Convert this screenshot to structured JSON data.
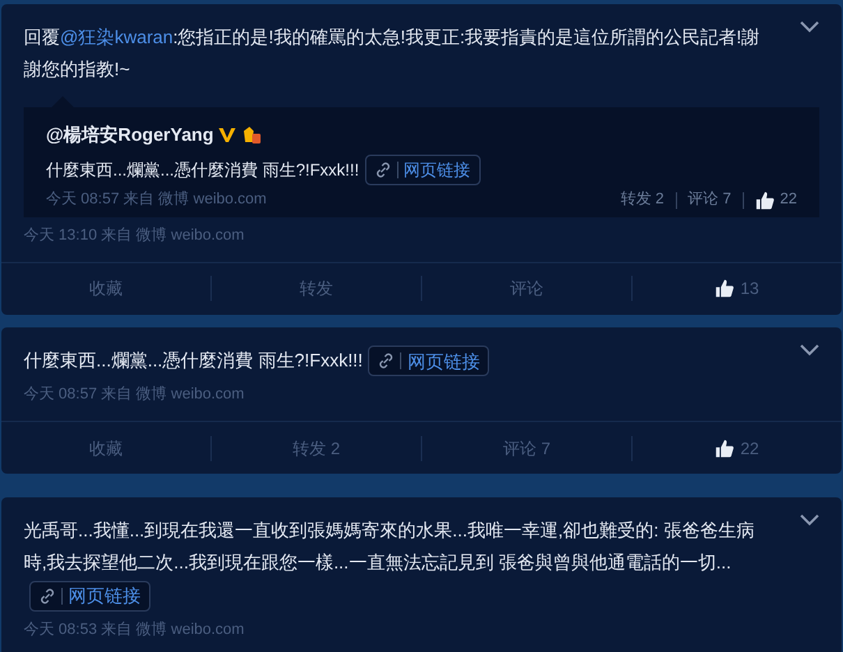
{
  "posts": [
    {
      "text": [
        {
          "kind": "text",
          "value": "回覆"
        },
        {
          "kind": "mention",
          "value": "@狂染kwaran"
        },
        {
          "kind": "text",
          "value": ":您指正的是!我的確罵的太急!我更正:我要指責的是這位所謂的公民記者!謝謝您的指教!~"
        }
      ],
      "repost": {
        "author": "@楊培安RogerYang",
        "text": "什麼東西...爛黨...憑什麼消費 雨生?!Fxxk!!!",
        "link": "网页链接",
        "meta": "今天 08:57 来自 微博 weibo.com",
        "stats": [
          {
            "kind": "repost",
            "label": "转发 2"
          },
          {
            "kind": "comment",
            "label": "评论 7"
          },
          {
            "kind": "like",
            "label": "22"
          }
        ]
      },
      "meta": "今天 13:10 来自 微博 weibo.com",
      "actions": [
        {
          "kind": "favorite",
          "label": "收藏"
        },
        {
          "kind": "repost",
          "label": "转发"
        },
        {
          "kind": "comment",
          "label": "评论"
        },
        {
          "kind": "like",
          "label": "13"
        }
      ]
    },
    {
      "text": [
        {
          "kind": "text",
          "value": "什麼東西...爛黨...憑什麼消費 雨生?!Fxxk!!!"
        }
      ],
      "link": "网页链接",
      "meta": "今天 08:57 来自 微博 weibo.com",
      "actions": [
        {
          "kind": "favorite",
          "label": "收藏"
        },
        {
          "kind": "repost",
          "label": "转发 2"
        },
        {
          "kind": "comment",
          "label": "评论 7"
        },
        {
          "kind": "like",
          "label": "22"
        }
      ]
    },
    {
      "text": [
        {
          "kind": "text",
          "value": "光禹哥...我懂...到現在我還一直收到張媽媽寄來的水果...我唯一幸運,卻也難受的: 張爸爸生病時,我去探望他二次...我到現在跟您一樣...一直無法忘記見到 張爸與曾與他通電話的一切..."
        }
      ],
      "link": "网页链接",
      "meta": "今天 08:53 来自 微博 weibo.com"
    }
  ]
}
